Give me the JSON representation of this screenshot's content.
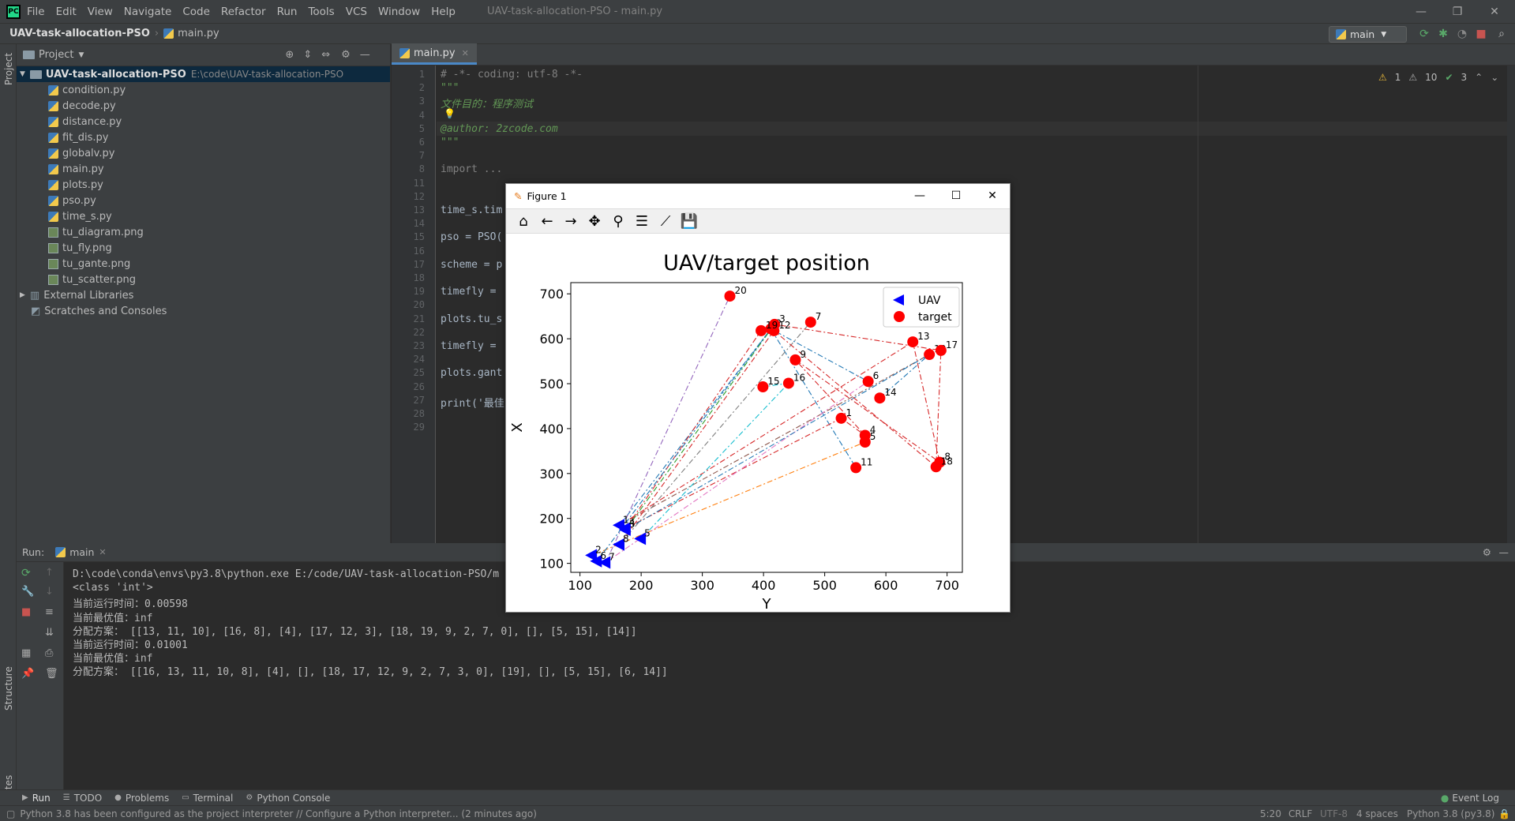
{
  "app": {
    "menu": [
      "File",
      "Edit",
      "View",
      "Navigate",
      "Code",
      "Refactor",
      "Run",
      "Tools",
      "VCS",
      "Window",
      "Help"
    ],
    "window_title": "UAV-task-allocation-PSO - main.py",
    "logo_text": "PC"
  },
  "navbar": {
    "project": "UAV-task-allocation-PSO",
    "file": "main.py",
    "run_config": "main"
  },
  "side_labels": {
    "project": "Project",
    "structure": "Structure",
    "favorites": "Favorites"
  },
  "project": {
    "header": "Project",
    "root_name": "UAV-task-allocation-PSO",
    "root_path": "E:\\code\\UAV-task-allocation-PSO",
    "files": [
      "condition.py",
      "decode.py",
      "distance.py",
      "fit_dis.py",
      "globalv.py",
      "main.py",
      "plots.py",
      "pso.py",
      "time_s.py",
      "tu_diagram.png",
      "tu_fly.png",
      "tu_gante.png",
      "tu_scatter.png"
    ],
    "external": "External Libraries",
    "scratches": "Scratches and Consoles"
  },
  "editor": {
    "tab": "main.py",
    "inspections": {
      "warn": "1",
      "weak": "10",
      "ok": "3"
    },
    "lines": [
      {
        "n": "1",
        "t": "# -*- coding: utf-8 -*-",
        "c": "cm"
      },
      {
        "n": "2",
        "t": "\"\"\"",
        "c": "doc"
      },
      {
        "n": "3",
        "t": "文件目的：程序测试",
        "c": "doc"
      },
      {
        "n": "4",
        "t": "",
        "c": ""
      },
      {
        "n": "5",
        "t": "@author: 2zcode.com",
        "c": "doc"
      },
      {
        "n": "6",
        "t": "\"\"\"",
        "c": "doc"
      },
      {
        "n": "7",
        "t": "",
        "c": ""
      },
      {
        "n": "8",
        "t": "import ...",
        "c": "cm"
      },
      {
        "n": "11",
        "t": "",
        "c": ""
      },
      {
        "n": "12",
        "t": "",
        "c": ""
      },
      {
        "n": "13",
        "t": "time_s.tim",
        "c": ""
      },
      {
        "n": "14",
        "t": "",
        "c": ""
      },
      {
        "n": "15",
        "t": "pso = PSO(",
        "c": ""
      },
      {
        "n": "16",
        "t": "",
        "c": ""
      },
      {
        "n": "17",
        "t": "scheme = p",
        "c": ""
      },
      {
        "n": "18",
        "t": "",
        "c": ""
      },
      {
        "n": "19",
        "t": "timefly = ",
        "c": ""
      },
      {
        "n": "20",
        "t": "",
        "c": ""
      },
      {
        "n": "21",
        "t": "plots.tu_s",
        "c": ""
      },
      {
        "n": "22",
        "t": "",
        "c": ""
      },
      {
        "n": "23",
        "t": "timefly = ",
        "c": ""
      },
      {
        "n": "24",
        "t": "",
        "c": ""
      },
      {
        "n": "25",
        "t": "plots.gant",
        "c": ""
      },
      {
        "n": "26",
        "t": "",
        "c": ""
      },
      {
        "n": "27",
        "t": "print('最佳",
        "c": ""
      },
      {
        "n": "28",
        "t": "",
        "c": ""
      },
      {
        "n": "29",
        "t": "",
        "c": ""
      }
    ]
  },
  "run": {
    "label": "Run:",
    "tab": "main",
    "output": [
      "D:\\code\\conda\\envs\\py3.8\\python.exe E:/code/UAV-task-allocation-PSO/m",
      "<class 'int'>",
      "当前运行时间：0.00598",
      "当前最优值：inf",
      "分配方案： [[13, 11, 10], [16, 8], [4], [17, 12, 3], [18, 19, 9, 2, 7, 0], [], [5, 15], [14]]",
      "当前运行时间：0.01001",
      "当前最优值：inf",
      "分配方案： [[16, 13, 11, 10, 8], [4], [], [18, 17, 12, 9, 2, 7, 3, 0], [19], [], [5, 15], [6, 14]]"
    ]
  },
  "bottom_tabs": [
    "Run",
    "TODO",
    "Problems",
    "Terminal",
    "Python Console"
  ],
  "event_log": "Event Log",
  "status": {
    "message": "Python 3.8 has been configured as the project interpreter // Configure a Python interpreter... (2 minutes ago)",
    "pos": "5:20",
    "eol": "CRLF",
    "enc": "UTF-8",
    "indent": "4 spaces",
    "interp": "Python 3.8 (py3.8)"
  },
  "figure": {
    "title": "Figure 1"
  },
  "chart_data": {
    "type": "scatter",
    "title": "UAV/target position",
    "xlabel": "Y",
    "ylabel": "X",
    "xlim": [
      85,
      725
    ],
    "ylim": [
      80,
      725
    ],
    "xticks": [
      100,
      200,
      300,
      400,
      500,
      600,
      700
    ],
    "yticks": [
      100,
      200,
      300,
      400,
      500,
      600,
      700
    ],
    "legend": [
      "UAV",
      "target"
    ],
    "legend_position": "top-right",
    "uavs": [
      {
        "label": "1",
        "x": 165,
        "y": 185
      },
      {
        "label": "2",
        "x": 120,
        "y": 118
      },
      {
        "label": "3",
        "x": 175,
        "y": 175
      },
      {
        "label": "4",
        "x": 175,
        "y": 178
      },
      {
        "label": "5",
        "x": 200,
        "y": 155
      },
      {
        "label": "6",
        "x": 128,
        "y": 105
      },
      {
        "label": "7",
        "x": 142,
        "y": 102
      },
      {
        "label": "8",
        "x": 165,
        "y": 142
      }
    ],
    "targets": [
      {
        "label": "1",
        "x": 527,
        "y": 423
      },
      {
        "label": "2",
        "x": 412,
        "y": 622
      },
      {
        "label": "3",
        "x": 418,
        "y": 632
      },
      {
        "label": "4",
        "x": 566,
        "y": 385
      },
      {
        "label": "5",
        "x": 566,
        "y": 370
      },
      {
        "label": "6",
        "x": 571,
        "y": 505
      },
      {
        "label": "7",
        "x": 477,
        "y": 637
      },
      {
        "label": "8",
        "x": 688,
        "y": 325
      },
      {
        "label": "9",
        "x": 452,
        "y": 553
      },
      {
        "label": "10",
        "x": 671,
        "y": 565
      },
      {
        "label": "11",
        "x": 551,
        "y": 313
      },
      {
        "label": "12",
        "x": 417,
        "y": 618
      },
      {
        "label": "13",
        "x": 644,
        "y": 593
      },
      {
        "label": "14",
        "x": 590,
        "y": 468
      },
      {
        "label": "15",
        "x": 399,
        "y": 493
      },
      {
        "label": "16",
        "x": 441,
        "y": 501
      },
      {
        "label": "17",
        "x": 690,
        "y": 574
      },
      {
        "label": "18",
        "x": 682,
        "y": 315
      },
      {
        "label": "19",
        "x": 396,
        "y": 618
      },
      {
        "label": "20",
        "x": 345,
        "y": 695
      }
    ],
    "routes": [
      {
        "color": "#1f77b4",
        "points": [
          [
            165,
            185
          ],
          [
            412,
            622
          ],
          [
            551,
            313
          ]
        ]
      },
      {
        "color": "#ff7f0e",
        "points": [
          [
            120,
            118
          ],
          [
            566,
            370
          ]
        ]
      },
      {
        "color": "#2ca02c",
        "points": [
          [
            175,
            175
          ],
          [
            418,
            632
          ]
        ]
      },
      {
        "color": "#d62728",
        "points": [
          [
            175,
            178
          ],
          [
            527,
            423
          ],
          [
            566,
            385
          ]
        ]
      },
      {
        "color": "#9467bd",
        "points": [
          [
            142,
            102
          ],
          [
            345,
            695
          ]
        ]
      },
      {
        "color": "#8c564b",
        "points": [
          [
            165,
            185
          ],
          [
            671,
            565
          ]
        ]
      },
      {
        "color": "#e377c2",
        "points": [
          [
            142,
            102
          ],
          [
            571,
            505
          ]
        ]
      },
      {
        "color": "#7f7f7f",
        "points": [
          [
            165,
            142
          ],
          [
            477,
            637
          ]
        ]
      },
      {
        "color": "#d62728",
        "points": [
          [
            175,
            178
          ],
          [
            396,
            618
          ],
          [
            418,
            632
          ],
          [
            690,
            574
          ],
          [
            682,
            315
          ]
        ]
      },
      {
        "color": "#d62728",
        "points": [
          [
            165,
            185
          ],
          [
            644,
            593
          ],
          [
            688,
            325
          ],
          [
            452,
            553
          ],
          [
            566,
            385
          ]
        ]
      },
      {
        "color": "#1f77b4",
        "points": [
          [
            175,
            175
          ],
          [
            671,
            565
          ],
          [
            590,
            468
          ]
        ]
      },
      {
        "color": "#17becf",
        "points": [
          [
            200,
            155
          ],
          [
            441,
            501
          ],
          [
            399,
            493
          ]
        ]
      },
      {
        "color": "#d62728",
        "points": [
          [
            165,
            142
          ],
          [
            417,
            618
          ],
          [
            682,
            315
          ]
        ]
      },
      {
        "color": "#1f77b4",
        "points": [
          [
            128,
            105
          ],
          [
            412,
            622
          ],
          [
            571,
            505
          ]
        ]
      }
    ]
  }
}
